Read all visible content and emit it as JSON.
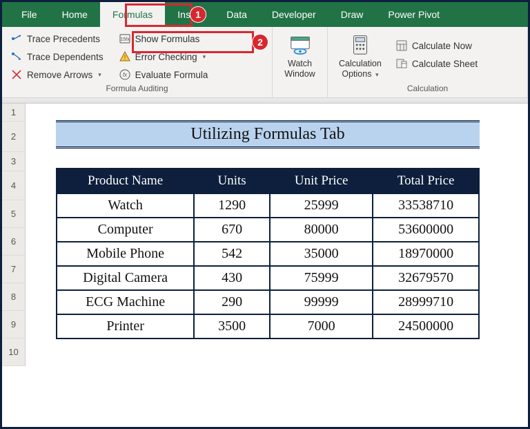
{
  "tabs": {
    "file": "File",
    "home": "Home",
    "formulas": "Formulas",
    "insert": "Insert",
    "data": "Data",
    "developer": "Developer",
    "draw": "Draw",
    "powerpivot": "Power Pivot"
  },
  "callouts": {
    "one": "1",
    "two": "2"
  },
  "ribbon": {
    "auditing": {
      "trace_precedents": "Trace Precedents",
      "trace_dependents": "Trace Dependents",
      "remove_arrows": "Remove Arrows",
      "show_formulas": "Show Formulas",
      "error_checking": "Error Checking",
      "evaluate_formula": "Evaluate Formula",
      "group_label": "Formula Auditing"
    },
    "watch": {
      "line1": "Watch",
      "line2": "Window"
    },
    "calc": {
      "options_line1": "Calculation",
      "options_line2": "Options",
      "calc_now": "Calculate Now",
      "calc_sheet": "Calculate Sheet",
      "group_label": "Calculation"
    }
  },
  "rows": [
    "1",
    "2",
    "3",
    "4",
    "5",
    "6",
    "7",
    "8",
    "9",
    "10"
  ],
  "title": "Utilizing Formulas Tab",
  "headers": {
    "product": "Product Name",
    "units": "Units",
    "unit_price": "Unit Price",
    "total": "Total Price"
  },
  "chart_data": {
    "type": "table",
    "columns": [
      "Product Name",
      "Units",
      "Unit Price",
      "Total Price"
    ],
    "rows": [
      {
        "product": "Watch",
        "units": 1290,
        "unit_price": 25999,
        "total": 33538710
      },
      {
        "product": "Computer",
        "units": 670,
        "unit_price": 80000,
        "total": 53600000
      },
      {
        "product": "Mobile Phone",
        "units": 542,
        "unit_price": 35000,
        "total": 18970000
      },
      {
        "product": "Digital Camera",
        "units": 430,
        "unit_price": 75999,
        "total": 32679570
      },
      {
        "product": "ECG Machine",
        "units": 290,
        "unit_price": 99999,
        "total": 28999710
      },
      {
        "product": "Printer",
        "units": 3500,
        "unit_price": 7000,
        "total": 24500000
      }
    ]
  }
}
